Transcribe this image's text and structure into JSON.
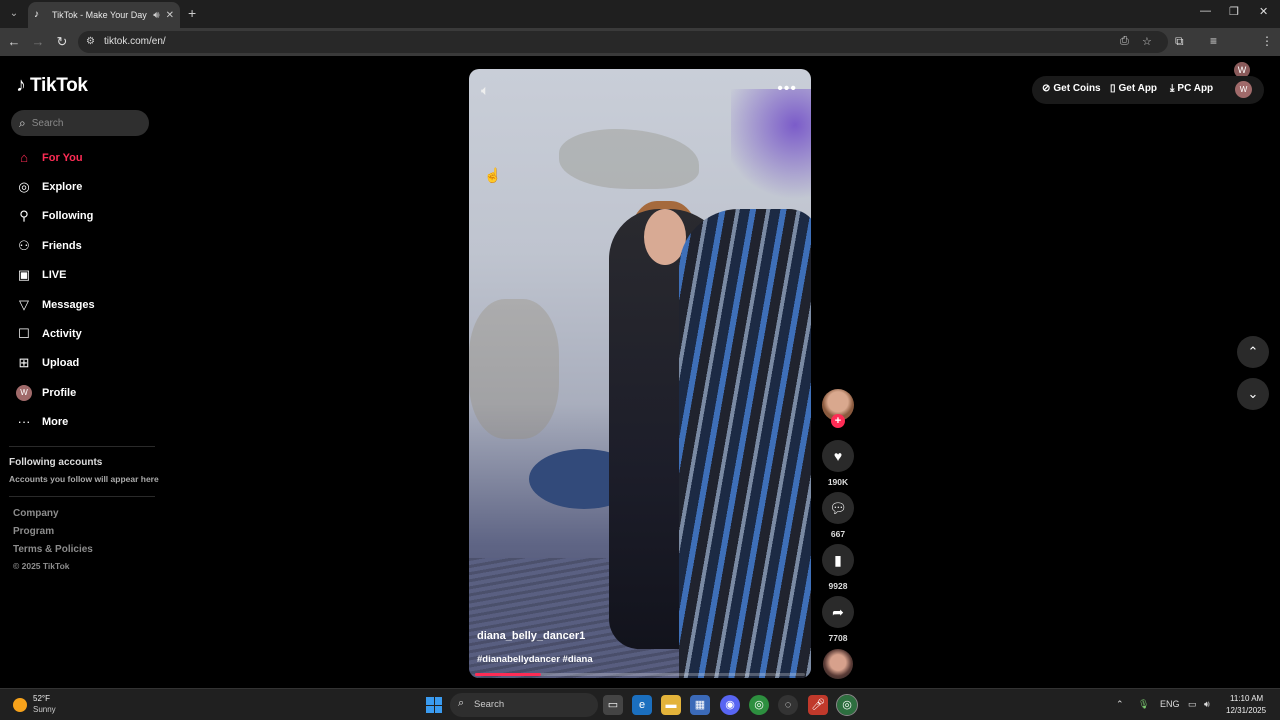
{
  "browser": {
    "tab_title": "TikTok - Make Your Day",
    "url": "tiktok.com/en/",
    "profile_initial": "W"
  },
  "sidebar": {
    "logo_text": "TikTok",
    "search_placeholder": "Search",
    "nav": [
      {
        "label": "For You",
        "icon": "home-icon",
        "active": true
      },
      {
        "label": "Explore",
        "icon": "compass-icon"
      },
      {
        "label": "Following",
        "icon": "following-icon"
      },
      {
        "label": "Friends",
        "icon": "friends-icon"
      },
      {
        "label": "LIVE",
        "icon": "live-icon"
      },
      {
        "label": "Messages",
        "icon": "messages-icon"
      },
      {
        "label": "Activity",
        "icon": "activity-icon"
      },
      {
        "label": "Upload",
        "icon": "upload-icon"
      },
      {
        "label": "Profile",
        "icon": "profile-avatar",
        "initial": "W"
      },
      {
        "label": "More",
        "icon": "more-icon"
      }
    ],
    "following_title": "Following accounts",
    "following_sub": "Accounts you follow will appear here",
    "footer": [
      "Company",
      "Program",
      "Terms & Policies"
    ],
    "copyright": "© 2025 TikTok"
  },
  "video": {
    "author": "diana_belly_dancer1",
    "hashtags": "#dianabellydancer #diana",
    "progress": 0.2
  },
  "actions": {
    "likes": "190K",
    "comments": "667",
    "saves": "9928",
    "shares": "7708"
  },
  "top_actions": {
    "coins": "Get Coins",
    "app": "Get App",
    "pc_app": "PC App",
    "avatar_initial": "W"
  },
  "taskbar": {
    "temp": "52°F",
    "condition": "Sunny",
    "search_label": "Search",
    "lang": "ENG",
    "time": "11:10 AM",
    "date": "12/31/2025"
  },
  "colors": {
    "accent": "#fe2c55",
    "bg": "#000000"
  }
}
